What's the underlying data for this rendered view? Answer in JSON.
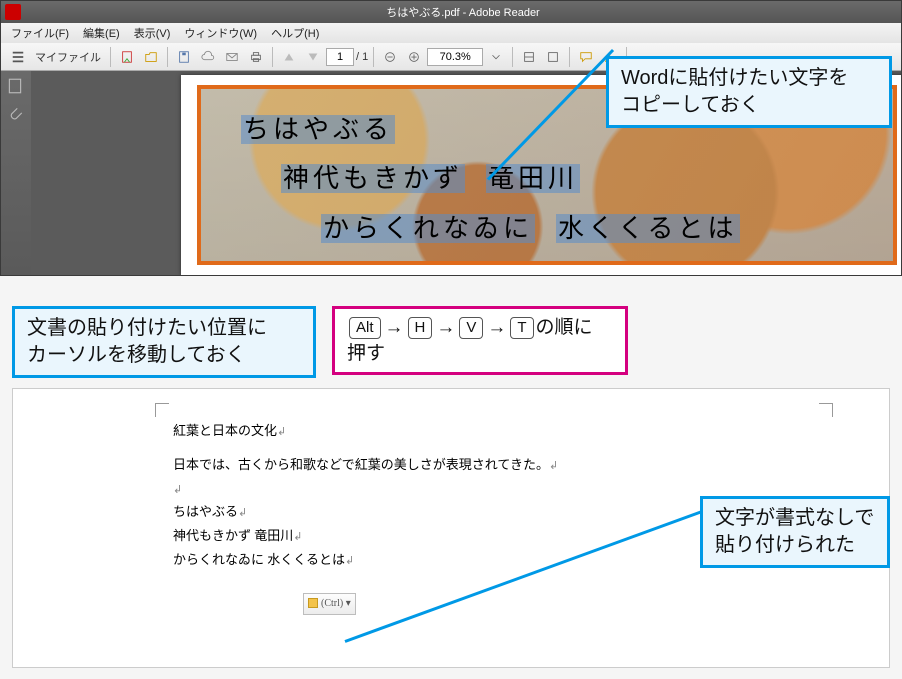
{
  "reader": {
    "title": "ちはやぶる.pdf - Adobe Reader",
    "menu": {
      "file": "ファイル(F)",
      "edit": "編集(E)",
      "view": "表示(V)",
      "window": "ウィンドウ(W)",
      "help": "ヘルプ(H)"
    },
    "toolbar": {
      "myfile": "マイファイル",
      "page_value": "1",
      "page_total": "/ 1",
      "zoom": "70.3%"
    },
    "poem": {
      "line1": "ちはやぶる",
      "line2a": "神代もきかず",
      "line2b": "竜田川",
      "line3a": "からくれなゐに",
      "line3b": "水くくるとは"
    }
  },
  "callouts": {
    "c1_line1": "Wordに貼付けたい文字を",
    "c1_line2": "コピーしておく",
    "c2_line1": "文書の貼り付けたい位置に",
    "c2_line2": "カーソルを移動しておく",
    "c3_tail": "の順に",
    "c3_line2": "押す",
    "c4_line1": "文字が書式なしで",
    "c4_line2": "貼り付けられた",
    "keys": {
      "alt": "Alt",
      "h": "H",
      "v": "V",
      "t": "T"
    },
    "arrow": "→"
  },
  "word": {
    "title": "紅葉と日本の文化",
    "body1": "日本では、古くから和歌などで紅葉の美しさが表現されてきた。",
    "p1": "ちはやぶる",
    "p2": "神代もきかず 竜田川",
    "p3": "からくれなゐに 水くくるとは",
    "paste_label": "(Ctrl) ▾"
  }
}
